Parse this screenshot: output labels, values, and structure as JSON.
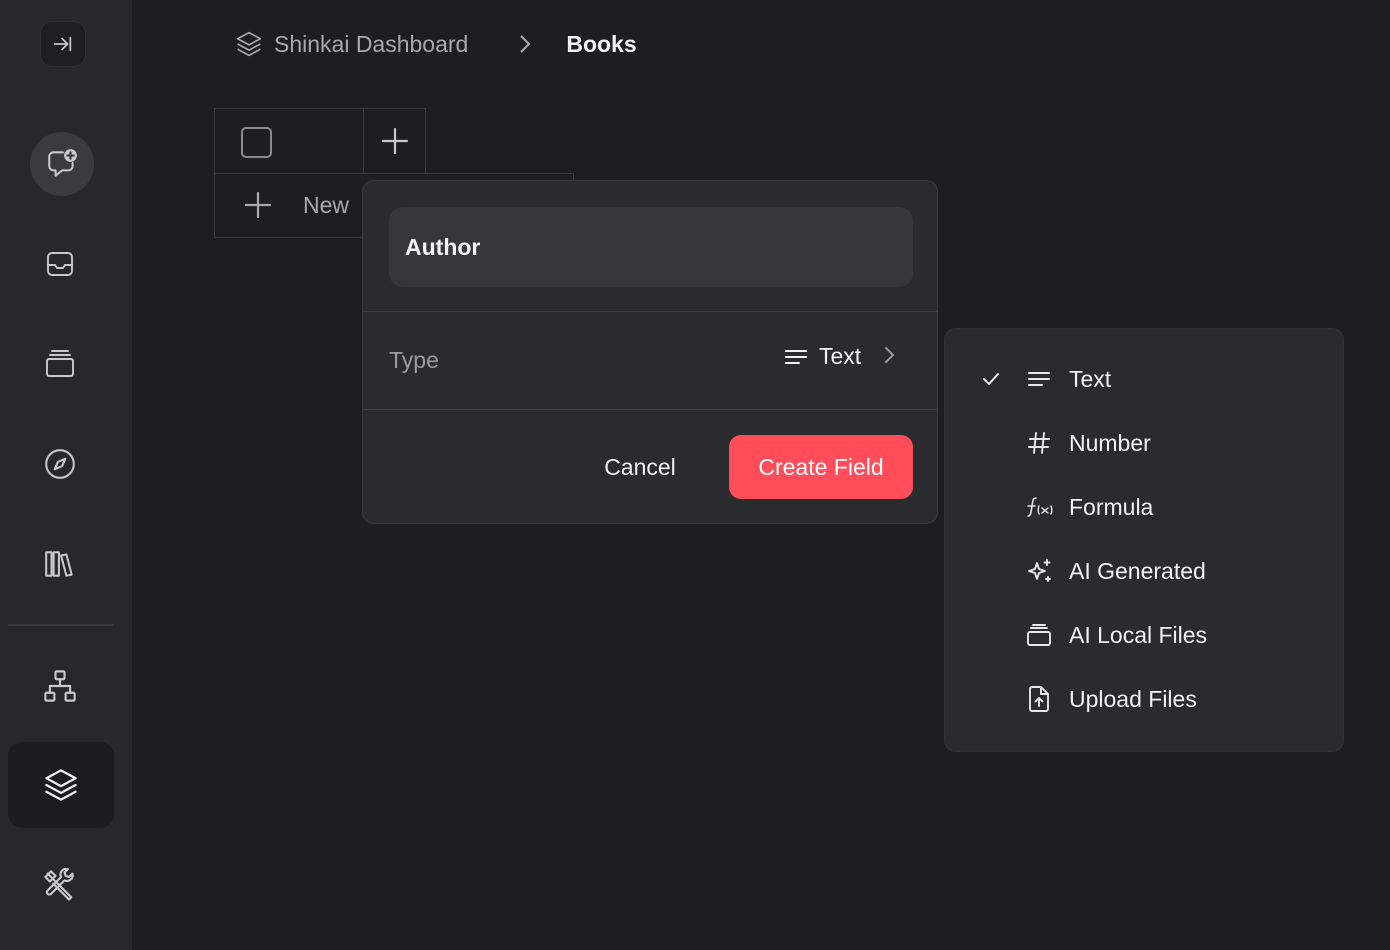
{
  "breadcrumb": {
    "root": "Shinkai Dashboard",
    "current": "Books"
  },
  "table": {
    "new_row_label": "New"
  },
  "field_popover": {
    "name_value": "Author",
    "type_label": "Type",
    "type_value": "Text",
    "cancel_label": "Cancel",
    "create_label": "Create Field"
  },
  "type_menu": {
    "items": [
      {
        "label": "Text",
        "icon": "text-lines-icon",
        "selected": true
      },
      {
        "label": "Number",
        "icon": "hash-icon",
        "selected": false
      },
      {
        "label": "Formula",
        "icon": "formula-icon",
        "selected": false
      },
      {
        "label": "AI Generated",
        "icon": "sparkles-icon",
        "selected": false
      },
      {
        "label": "AI Local Files",
        "icon": "stack-icon",
        "selected": false
      },
      {
        "label": "Upload Files",
        "icon": "file-upload-icon",
        "selected": false
      }
    ]
  },
  "colors": {
    "accent": "#ff4d5a",
    "background": "#1d1e22",
    "sidebar": "#27282c",
    "panel": "#2a2b2f"
  }
}
